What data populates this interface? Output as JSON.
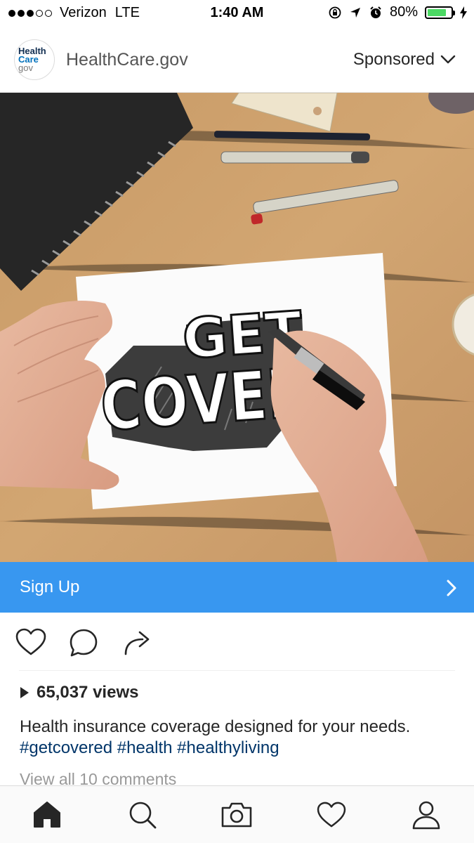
{
  "status_bar": {
    "carrier": "Verizon",
    "network": "LTE",
    "time": "1:40 AM",
    "battery_text": "80%",
    "battery_level": 0.8,
    "icons": [
      "signal-dots",
      "screen-lock-icon",
      "location-arrow-icon",
      "alarm-icon",
      "battery-icon",
      "charging-bolt-icon"
    ]
  },
  "post": {
    "avatar_lines": [
      "Health",
      "Care",
      "gov"
    ],
    "account_name": "HealthCare.gov",
    "sponsored_label": "Sponsored",
    "media": {
      "lettering": [
        "GET",
        "COVER"
      ]
    },
    "cta_label": "Sign Up",
    "views_text": "65,037 views",
    "caption_text": "Health insurance coverage designed for your needs.",
    "hashtags_text": "#getcovered #health #healthyliving",
    "comments_link": "View all 10 comments"
  },
  "colors": {
    "cta_blue": "#3897f0",
    "hashtag_blue": "#003569",
    "battery_green": "#4cd964"
  },
  "tabs": [
    "home-icon",
    "search-icon",
    "camera-icon",
    "heart-icon",
    "profile-icon"
  ]
}
